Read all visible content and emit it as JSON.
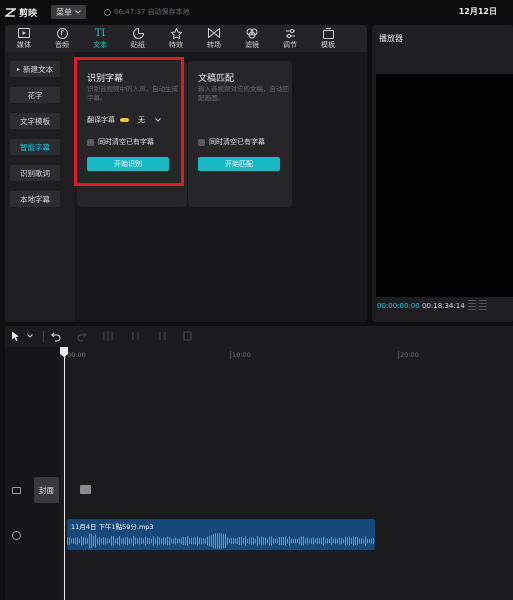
{
  "app": {
    "name": "剪映",
    "menu_label": "菜单",
    "autosave_text": "06:47:37 自动保存本地",
    "date": "12月12日"
  },
  "toolbar": {
    "items": [
      {
        "label": "媒体",
        "icon": "media-icon"
      },
      {
        "label": "音频",
        "icon": "audio-icon"
      },
      {
        "label": "文本",
        "icon": "text-icon",
        "active": true
      },
      {
        "label": "贴纸",
        "icon": "sticker-icon"
      },
      {
        "label": "特效",
        "icon": "effects-icon"
      },
      {
        "label": "转场",
        "icon": "transition-icon"
      },
      {
        "label": "滤镜",
        "icon": "filter-icon"
      },
      {
        "label": "调节",
        "icon": "adjust-icon"
      },
      {
        "label": "模板",
        "icon": "template-icon"
      }
    ]
  },
  "sidebar": {
    "items": [
      {
        "label": "新建文本",
        "caret": "▸"
      },
      {
        "label": "花字"
      },
      {
        "label": "文字模板"
      },
      {
        "label": "智能字幕",
        "active": true
      },
      {
        "label": "识别歌词"
      },
      {
        "label": "本地字幕"
      }
    ]
  },
  "cards": {
    "recognize": {
      "title": "识别字幕",
      "description": "识别音视频中的人声，自动生成字幕。",
      "translate_label": "翻译字幕",
      "translate_value": "无",
      "clear_label": "同时清空已有字幕",
      "button": "开始识别"
    },
    "match": {
      "title": "文稿匹配",
      "description": "输入音视频对应的文稿，自动匹配画面。",
      "clear_label": "同时清空已有字幕",
      "button": "开始匹配"
    }
  },
  "player": {
    "title": "播放器",
    "current_time": "00:00:00:00",
    "total_time": "00:18:34:14"
  },
  "timeline": {
    "ruler": [
      "00:00",
      "10:00",
      "20:00"
    ],
    "cover_label": "封面",
    "audio_clip_name": "11月4日 下午1點59分.mp3"
  },
  "colors": {
    "accent": "#1fc9d6",
    "button": "#19b8c5",
    "highlight": "#e0182b",
    "clip": "#16497a"
  }
}
